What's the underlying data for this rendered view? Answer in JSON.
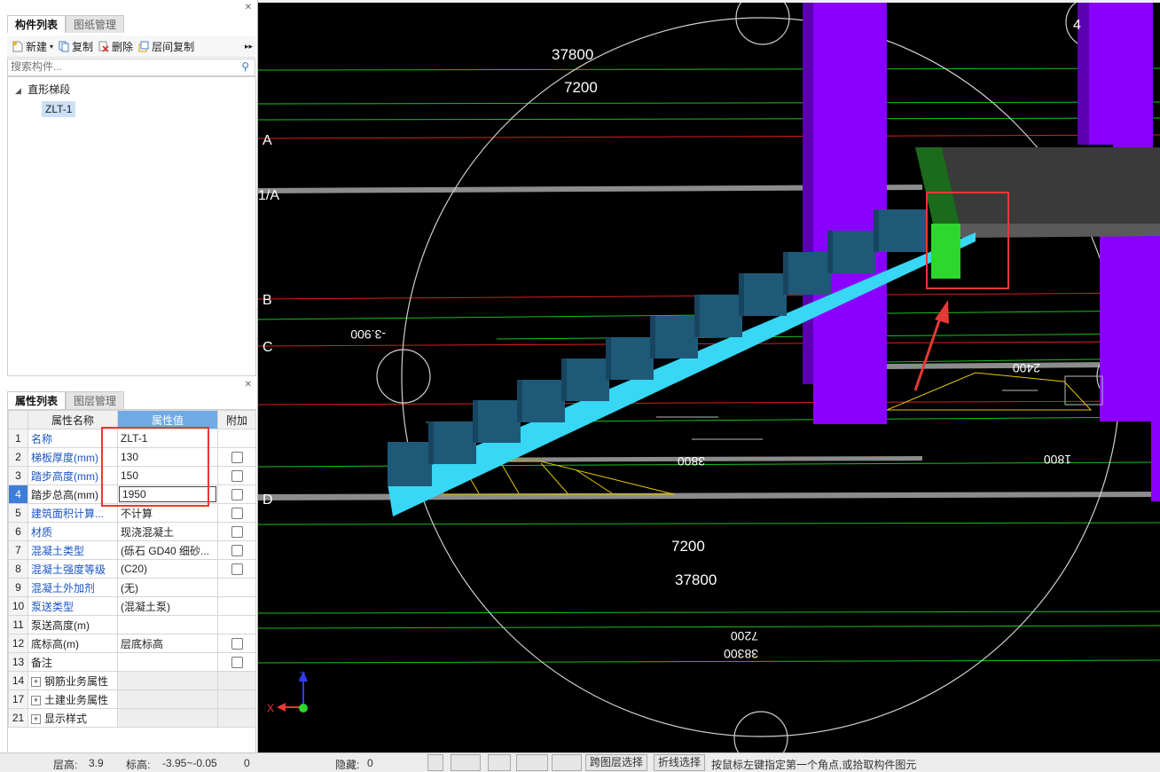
{
  "component_panel": {
    "tabs": [
      "构件列表",
      "图纸管理"
    ],
    "toolbar": {
      "new": "新建",
      "copy": "复制",
      "delete": "删除",
      "floor_copy": "层间复制"
    },
    "search_placeholder": "搜索构件...",
    "tree": {
      "group": "直形梯段",
      "item": "ZLT-1"
    }
  },
  "property_panel": {
    "tabs": [
      "属性列表",
      "图层管理"
    ],
    "headers": {
      "name": "属性名称",
      "value": "属性值",
      "extra": "附加"
    },
    "rows": [
      {
        "num": "1",
        "name": "名称",
        "value": "ZLT-1"
      },
      {
        "num": "2",
        "name": "梯板厚度(mm)",
        "value": "130"
      },
      {
        "num": "3",
        "name": "踏步高度(mm)",
        "value": "150"
      },
      {
        "num": "4",
        "name": "踏步总高(mm)",
        "value": "1950"
      },
      {
        "num": "5",
        "name": "建筑面积计算...",
        "value": "不计算"
      },
      {
        "num": "6",
        "name": "材质",
        "value": "现浇混凝土"
      },
      {
        "num": "7",
        "name": "混凝土类型",
        "value": "(砾石 GD40 细砂..."
      },
      {
        "num": "8",
        "name": "混凝土强度等级",
        "value": "(C20)"
      },
      {
        "num": "9",
        "name": "混凝土外加剂",
        "value": "(无)"
      },
      {
        "num": "10",
        "name": "泵送类型",
        "value": "(混凝土泵)"
      },
      {
        "num": "11",
        "name": "泵送高度(m)",
        "value": ""
      },
      {
        "num": "12",
        "name": "底标高(m)",
        "value": "层底标高"
      },
      {
        "num": "13",
        "name": "备注",
        "value": ""
      },
      {
        "num": "14",
        "name": "钢筋业务属性",
        "value": ""
      },
      {
        "num": "17",
        "name": "土建业务属性",
        "value": ""
      },
      {
        "num": "21",
        "name": "显示样式",
        "value": ""
      }
    ]
  },
  "viewport": {
    "dims": {
      "top1": "37800",
      "top2": "7200",
      "bot1": "7200",
      "bot2": "37800",
      "mirror_left": "-3.900",
      "mirror_2400": "2400",
      "mirror_3800": "3800",
      "mirror_1800": "1800",
      "mirror_7200": "7200",
      "mirror_38300": "38300"
    },
    "axes": {
      "a": "A",
      "a1": "1/A",
      "b": "B",
      "c": "C",
      "d": "D",
      "top_right": "4"
    },
    "coord": {
      "x": "X",
      "z": "Z"
    }
  },
  "status_bar": {
    "floor_label": "层高:",
    "floor_value": "3.9",
    "elev_label": "标高:",
    "elev_value": "-3.95~-0.05",
    "count": "0",
    "hidden_label": "隐藏:",
    "hidden_value": "0",
    "cross_layer": "跨图层选择",
    "polyline": "折线选择",
    "hint": "按鼠标左键指定第一个角点,或拾取构件图元"
  },
  "colors": {
    "stair": "#1e5a78",
    "slab": "#37d7f5",
    "column": "#8a00ff",
    "highlight": "#e53935",
    "selected_block": "#2ed72e"
  }
}
